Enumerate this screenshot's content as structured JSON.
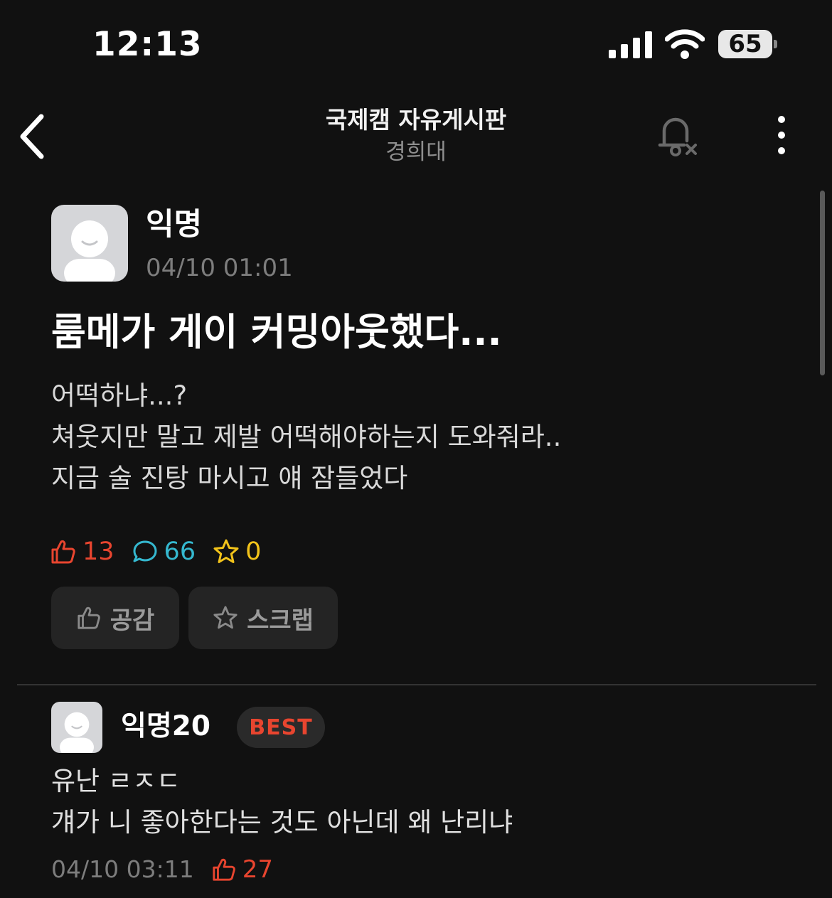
{
  "status_bar": {
    "time": "12:13",
    "battery": "65"
  },
  "header": {
    "title": "국제캠 자유게시판",
    "subtitle": "경희대",
    "back_icon": "chevron-left-icon",
    "notification_icon": "bell-off-icon",
    "more_icon": "more-vertical-icon"
  },
  "post": {
    "author": "익명",
    "date": "04/10 01:01",
    "title": "룸메가 게이 커밍아웃했다...",
    "body_lines": [
      "어떡하냐...?",
      "쳐웃지만 말고 제발 어떡해야하는지 도와줘라..",
      "지금 술 진탕 마시고 얘 잠들었다"
    ],
    "stats": {
      "likes": "13",
      "comments": "66",
      "scraps": "0"
    },
    "actions": {
      "like_label": "공감",
      "scrap_label": "스크랩"
    }
  },
  "comments": [
    {
      "author": "익명20",
      "badge": "BEST",
      "body_lines": [
        "유난 ㄹㅈㄷ",
        "걔가 니 좋아한다는 것도 아닌데 왜 난리냐"
      ],
      "date": "04/10 03:11",
      "likes": "27"
    }
  ],
  "colors": {
    "background": "#111111",
    "like_red": "#e8452f",
    "comment_cyan": "#35b8cf",
    "scrap_yellow": "#f2c31a",
    "muted_gray": "#7d7d7d",
    "button_bg": "#242424"
  }
}
